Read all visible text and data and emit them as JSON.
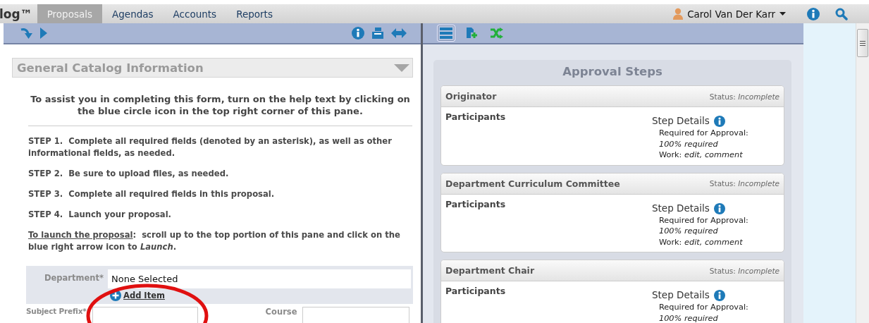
{
  "app": {
    "logo": "log™"
  },
  "tabs": [
    {
      "label": "Proposals",
      "selected": true
    },
    {
      "label": "Agendas",
      "selected": false
    },
    {
      "label": "Accounts",
      "selected": false
    },
    {
      "label": "Reports",
      "selected": false
    }
  ],
  "user": {
    "name": "Carol Van Der Karr"
  },
  "left_pane": {
    "section_title": "General Catalog Information",
    "intro": "To assist you in completing this form, turn on the help text by clicking on the blue circle icon in the top right corner of this pane.",
    "steps": [
      "STEP 1.  Complete all required fields (denoted by an asterisk), as well as other informational fields, as needed.",
      "STEP 2.  Be sure to upload files, as needed.",
      "STEP 3.  Complete all required fields in this proposal.",
      "STEP 4.  Launch your proposal."
    ],
    "launch_note": {
      "underlined": "To launch the proposal",
      "text": ":  scroll up to the top portion of this pane and click on the blue right arrow icon to *Launch*."
    },
    "department": {
      "label": "Department*",
      "value": "None Selected",
      "add_link": "Add Item",
      "highlighted": true
    },
    "fields": [
      {
        "label": "Subject Prefix*"
      },
      {
        "label": "Course"
      }
    ]
  },
  "right_pane": {
    "toolbar": [
      {
        "kind": "list",
        "selected": true
      },
      {
        "kind": "add",
        "selected": false
      },
      {
        "kind": "shuffle",
        "selected": false
      }
    ],
    "title": "Approval Steps",
    "steps": [
      {
        "name": "Originator",
        "status_label": "Status:",
        "status": "Incomplete",
        "participants": "Participants",
        "details_title": "Step Details",
        "required_label": "Required for Approval:",
        "required": "100% required",
        "work": "Work: *edit, comment*"
      },
      {
        "name": "Department Curriculum Committee",
        "status_label": "Status:",
        "status": "Incomplete",
        "participants": "Participants",
        "details_title": "Step Details",
        "required_label": "Required for Approval:",
        "required": "100% required",
        "work": "Work: *edit, comment*"
      },
      {
        "name": "Department Chair",
        "status_label": "Status:",
        "status": "Incomplete",
        "participants": "Participants",
        "details_title": "Step Details",
        "required_label": "Required for Approval:",
        "required": "100% required"
      }
    ]
  }
}
